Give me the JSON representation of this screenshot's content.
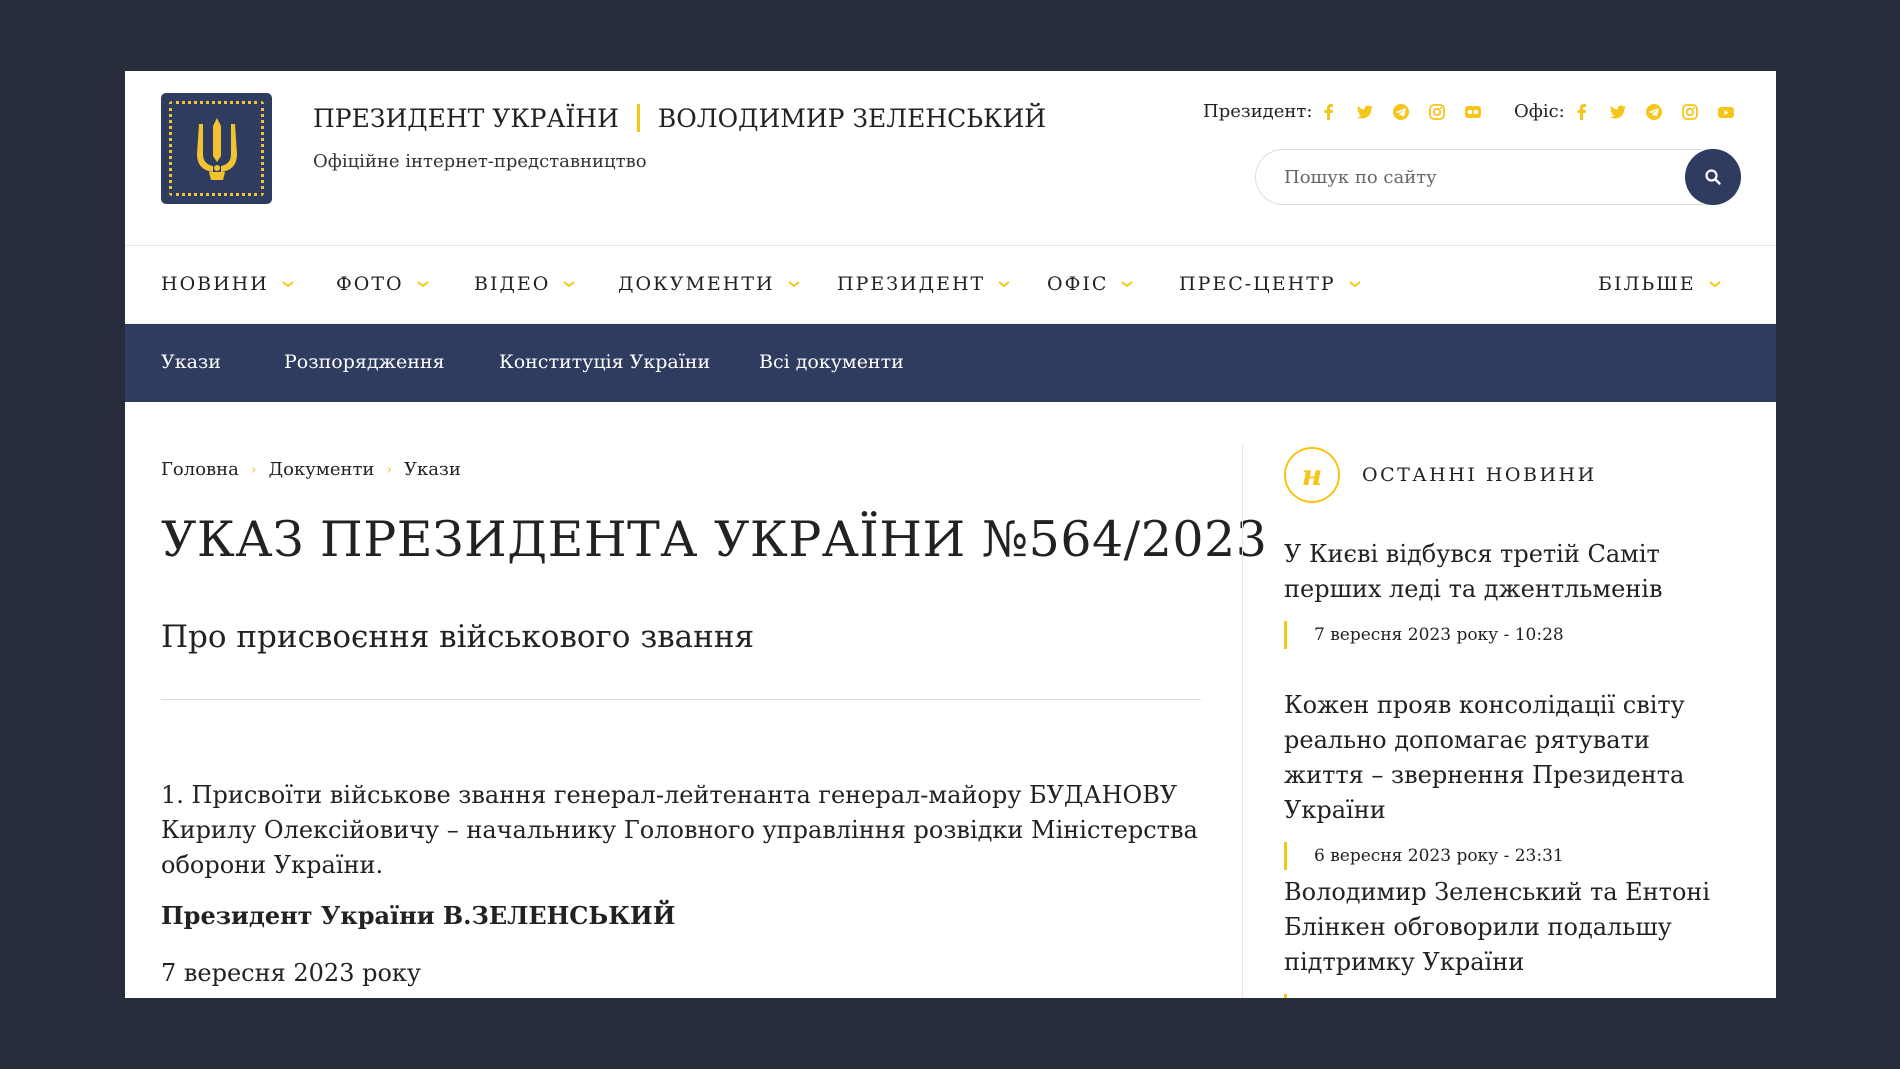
{
  "header": {
    "title_left": "ПРЕЗИДЕНТ УКРАЇНИ",
    "title_right": "ВОЛОДИМИР ЗЕЛЕНСЬКИЙ",
    "subtitle": "Офіційне інтернет-представництво",
    "president_label": "Президент:",
    "office_label": "Офіс:",
    "search_placeholder": "Пошук по сайту",
    "accent_color": "#f5c518",
    "brand_color": "#2f3c5f"
  },
  "main_nav": [
    "НОВИНИ",
    "ФОТО",
    "ВІДЕО",
    "ДОКУМЕНТИ",
    "ПРЕЗИДЕНТ",
    "ОФІС",
    "ПРЕС-ЦЕНТР",
    "БІЛЬШЕ"
  ],
  "sub_nav": [
    "Укази",
    "Розпорядження",
    "Конституція України",
    "Всі документи"
  ],
  "breadcrumb": [
    "Головна",
    "Документи",
    "Укази"
  ],
  "document": {
    "title": "УКАЗ ПРЕЗИДЕНТА УКРАЇНИ №564/2023",
    "subtitle": "Про присвоєння військового звання",
    "body": "1. Присвоїти військове звання генерал-лейтенанта генерал-майору БУДАНОВУ Кирилу Олексійовичу – начальнику Головного управління розвідки Міністерства оборони України.",
    "signature": "Президент України В.ЗЕЛЕНСЬКИЙ",
    "date": "7 вересня 2023 року"
  },
  "sidebar": {
    "badge": "н",
    "heading": "ОСТАННІ НОВИНИ",
    "news": [
      {
        "title": "У Києві відбувся третій Саміт перших леді та джентльменів",
        "date": "7 вересня 2023 року - 10:28"
      },
      {
        "title": "Кожен прояв консолідації світу реально допомагає рятувати життя – звернення Президента України",
        "date": "6 вересня 2023 року - 23:31"
      },
      {
        "title": "Володимир Зеленський та Ентоні Блінкен обговорили подальшу підтримку України",
        "date": ""
      }
    ]
  }
}
